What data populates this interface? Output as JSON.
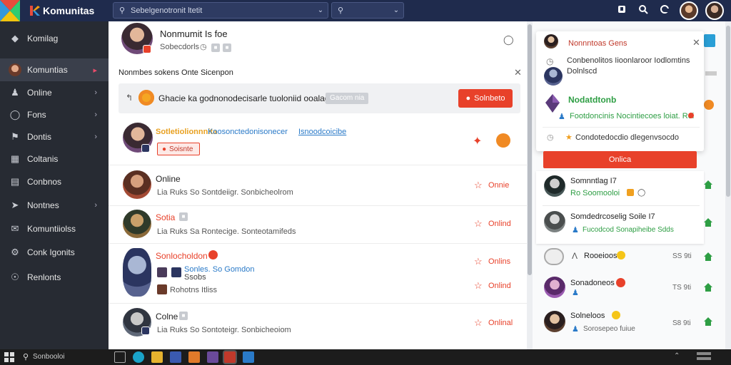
{
  "app": {
    "brand_name": "Komunitas",
    "search1_placeholder": "Sebelgenotronit ltetit",
    "search2_placeholder": ""
  },
  "sidebar": {
    "items": [
      {
        "label": "Komilag",
        "icon": "puzzle-icon"
      },
      {
        "label": "Komuntias",
        "icon": "avatar"
      },
      {
        "label": "Online",
        "icon": "people-icon"
      },
      {
        "label": "Fons",
        "icon": "toggle-icon"
      },
      {
        "label": "Dontis",
        "icon": "flag-icon"
      },
      {
        "label": "Coltanis",
        "icon": "grid-icon"
      },
      {
        "label": "Conbnos",
        "icon": "document-icon"
      },
      {
        "label": "Nontnes",
        "icon": "compass-icon"
      },
      {
        "label": "Komuntiiolss",
        "icon": "chat-icon"
      },
      {
        "label": "Conk Igonits",
        "icon": "settings-icon"
      },
      {
        "label": "Renlonts",
        "icon": "support-icon"
      }
    ]
  },
  "profile": {
    "name": "Nonmumit Is foe",
    "subtitle": "Sobecdorls"
  },
  "notice": {
    "text": "Nonmbes sokens Onte Sicenpon"
  },
  "composer": {
    "text": "Ghacie ka godnonodecisarle tuoloniid ooalages",
    "chip": "Gacom nia",
    "button": "Solnbeto"
  },
  "feed": [
    {
      "name": "Sotletiolionnnita",
      "name_link": "Koosonctedonisonecer",
      "name_link2": "Isnoodcoicibe",
      "tag": "Soisnte"
    },
    {
      "name": "Online",
      "sub": "Lia  Ruks So Sontdeiigr.  Sonbicheolrom",
      "status": "Onnie"
    },
    {
      "name": "Sotia",
      "sub": "Lia  Ruks Sa Rontecige.  Sonteotamifeds",
      "status": "Onlind"
    },
    {
      "name": "Sonlocholdon",
      "sub1": "Sonles. So Gomdon",
      "sub2": "Ssobs",
      "sub3": "Rohotns Itliss",
      "status": "Onlins",
      "status2": "Onlind"
    },
    {
      "name": "Colne",
      "sub": "Lia  Ruks So Sontoteigr.  Sonbicheoiom",
      "status": "Onlinal"
    }
  ],
  "popup": {
    "title": "Nonnntoas Gens",
    "line1": "Conbenolitos Iioonlaroor Iodlomtins",
    "line2": "Dolnlscd",
    "highlight": "Nodatdtonb",
    "highlight_sub": "Footdoncinis Nocintiecoes loiat. Rei",
    "row3": "Condotedocdio dlegenvsocdo",
    "online_button": "Onlica"
  },
  "right_list": [
    {
      "name": "Somnntlag  I7",
      "sub": "Ro Soomooloi"
    },
    {
      "name": "Somdedrcoselig Soile  I7",
      "sub": "Fucodcod Sonapiheibe Sdds"
    },
    {
      "name": "Rooeioos",
      "meta": "SS 9ti"
    },
    {
      "name": "Sonadoneos",
      "meta": "TS 9ti"
    },
    {
      "name": "Solneloos",
      "sub": "Sorosepeo fuiue",
      "meta": "S8 9ti"
    }
  ],
  "taskbar": {
    "search": "Sonbooloi"
  },
  "colors": {
    "topbar": "#1f2b4d",
    "sidebar": "#272b33",
    "accent_red": "#e8412a",
    "green": "#2e9e44",
    "orange": "#f08a24"
  }
}
